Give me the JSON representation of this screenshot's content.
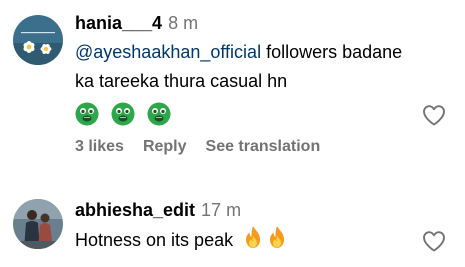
{
  "comments": [
    {
      "username": "hania___4",
      "time": "8 m",
      "mention": "@ayeshaakhan_official",
      "text_after_mention": " followers badane ka tareeka thura casual hn",
      "emoji_icon": "nauseated-face-emoji",
      "emoji_count": 3,
      "likes": "3 likes",
      "reply_label": "Reply",
      "translate_label": "See translation",
      "liked": false
    },
    {
      "username": "abhiesha_edit",
      "time": "17 m",
      "text": "Hotness on its peak",
      "emoji_icon": "fire-emoji",
      "emoji_count": 2,
      "liked": false
    }
  ],
  "colors": {
    "text": "#000000",
    "meta": "#737373",
    "mention": "#00376b",
    "emoji_green": "#2ca84a",
    "fire_orange": "#f59a1b"
  }
}
